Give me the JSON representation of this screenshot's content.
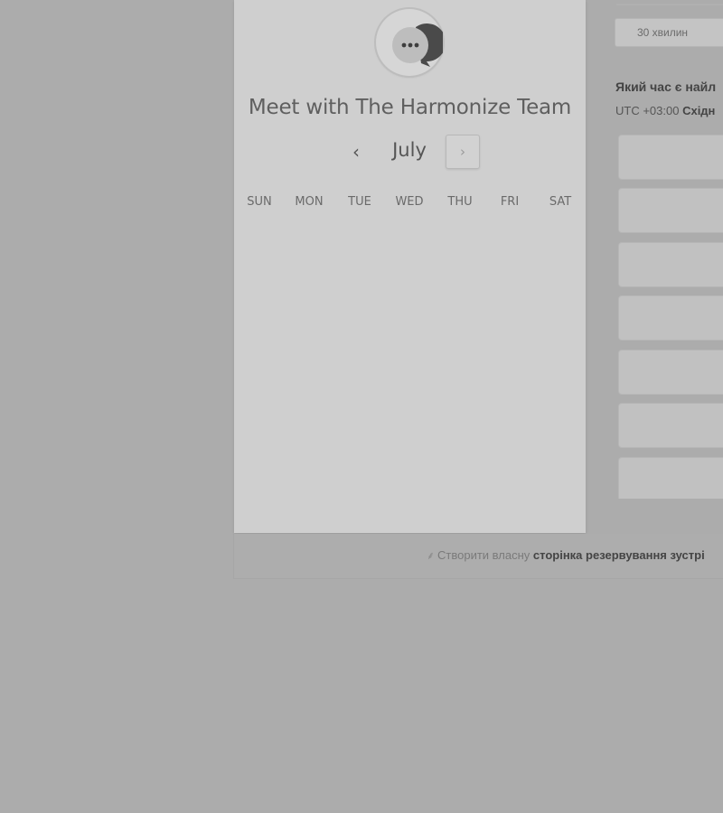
{
  "calendar": {
    "title": "Meet with The Harmonize Team",
    "month": "July",
    "prev_icon": "‹",
    "next_icon": "›",
    "weekdays": [
      "SUN",
      "MON",
      "TUE",
      "WED",
      "THU",
      "FRI",
      "SAT"
    ],
    "logo_icon": "chat-bubble-icon"
  },
  "duration": {
    "option_1": "30 хвилин"
  },
  "times": {
    "question": "Який час є найл",
    "timezone_offset": "UTC +03:00",
    "timezone_name": "Східн"
  },
  "footer": {
    "icon": "sprocket-icon",
    "prefix": "Створити власну",
    "link": "сторінка резервування зустрі"
  },
  "colors": {
    "overlay_background": "#acacac",
    "card_background": "#cfcfcf"
  }
}
